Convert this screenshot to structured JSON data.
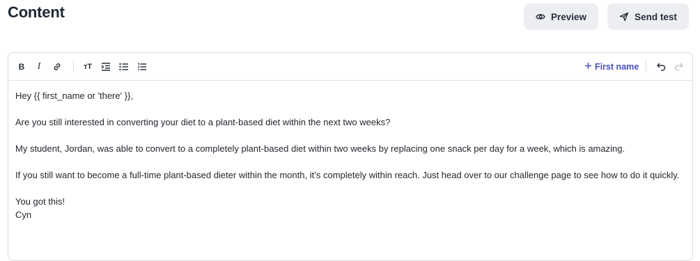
{
  "page": {
    "title": "Content"
  },
  "header_actions": {
    "preview_label": "Preview",
    "send_test_label": "Send test"
  },
  "toolbar": {
    "bold_label": "B",
    "italic_label": "I",
    "text_size_label": "тT",
    "merge_tag_label": "First name",
    "icons": [
      "bold-icon",
      "italic-icon",
      "link-icon",
      "text-size-icon",
      "indent-icon",
      "bullet-list-icon",
      "numbered-list-icon",
      "plus-icon",
      "undo-icon",
      "redo-icon"
    ]
  },
  "email": {
    "greeting": "Hey {{ first_name or 'there' }},",
    "paragraph1": "Are you still interested in converting your diet to a plant-based diet within the next two weeks?",
    "paragraph2": "My student, Jordan, was able to convert to a completely plant-based diet within two weeks by replacing one snack per day for a week, which is amazing.",
    "paragraph3": "If you still want to become a full-time plant-based dieter within the month, it’s completely within reach. Just head over to our challenge page to see how to do it quickly.",
    "signoff": "You got this!",
    "signature": "Cyn"
  },
  "colors": {
    "accent": "#4a4fb8",
    "button_bg": "#edeef2",
    "border": "#d8dbe0"
  }
}
